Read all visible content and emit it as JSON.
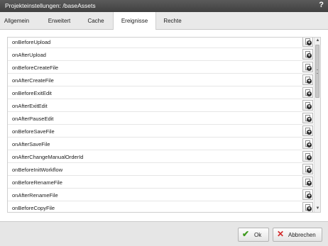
{
  "window": {
    "title": "Projekteinstellungen: /baseAssets",
    "help_label": "?"
  },
  "tabs": [
    {
      "label": "Allgemein"
    },
    {
      "label": "Erweitert"
    },
    {
      "label": "Cache"
    },
    {
      "label": "Ereignisse"
    },
    {
      "label": "Rechte"
    }
  ],
  "active_tab": "Ereignisse",
  "events": [
    {
      "label": "onBeforeUpload"
    },
    {
      "label": "onAfterUpload"
    },
    {
      "label": "onBeforeCreateFile"
    },
    {
      "label": "onAfterCreateFile"
    },
    {
      "label": "onBeforeExitEdit"
    },
    {
      "label": "onAfterExitEdit"
    },
    {
      "label": "onAfterPauseEdit"
    },
    {
      "label": "onBeforeSaveFile"
    },
    {
      "label": "onAfterSaveFile"
    },
    {
      "label": "onAfterChangeManualOrderId"
    },
    {
      "label": "onBeforeInitWorkflow"
    },
    {
      "label": "onBeforeRenameFile"
    },
    {
      "label": "onAfterRenameFile"
    },
    {
      "label": "onBeforeCopyFile"
    }
  ],
  "row_button_icon": "add-page-icon",
  "footer": {
    "ok_label": "Ok",
    "cancel_label": "Abbrechen",
    "ok_icon": "checkmark-icon",
    "cancel_icon": "cross-icon"
  },
  "colors": {
    "titlebar": "#4a4a4a",
    "ok_accent": "#3e9a1e",
    "cancel_accent": "#d22a2a"
  }
}
